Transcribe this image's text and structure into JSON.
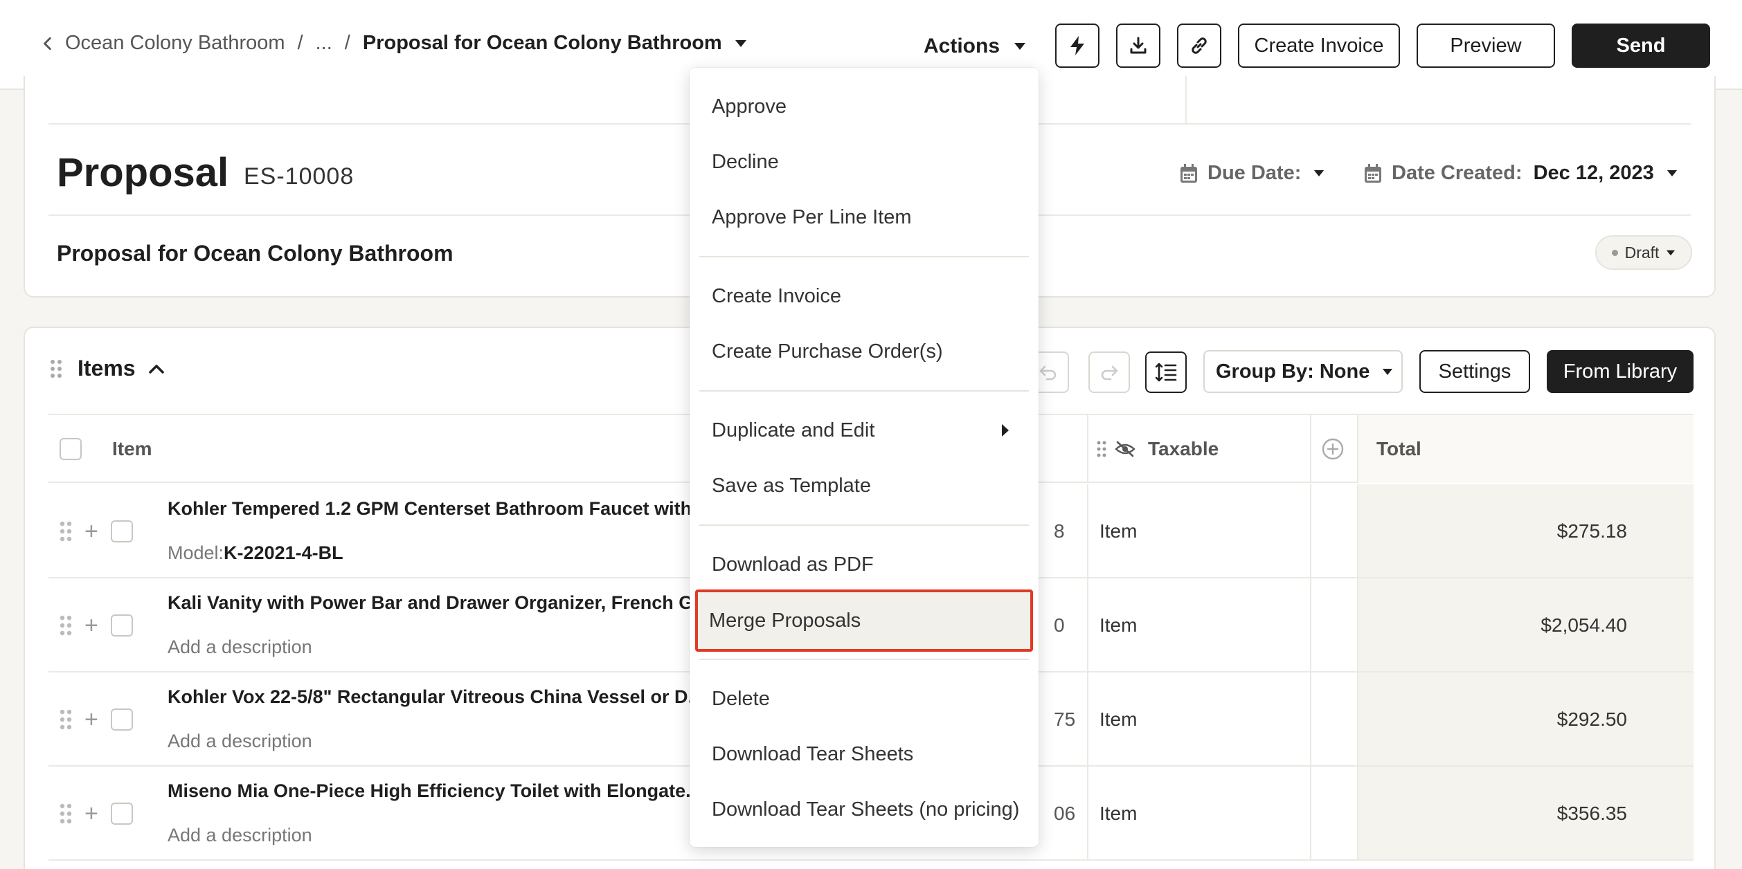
{
  "breadcrumb": {
    "parent": "Ocean Colony Bathroom",
    "separator": "/",
    "ellipsis": "...",
    "current": "Proposal for Ocean Colony Bathroom"
  },
  "toolbar": {
    "actions_label": "Actions",
    "create_invoice_label": "Create Invoice",
    "preview_label": "Preview",
    "send_label": "Send"
  },
  "proposal": {
    "title": "Proposal",
    "number": "ES-10008",
    "due_date_label": "Due Date:",
    "date_created_label": "Date Created:",
    "date_created_value": "Dec 12, 2023",
    "subtitle": "Proposal for Ocean Colony Bathroom",
    "status": "Draft"
  },
  "items": {
    "title": "Items",
    "group_by_label": "Group By: None",
    "settings_label": "Settings",
    "from_library_label": "From Library",
    "columns": {
      "item": "Item",
      "taxable": "Taxable",
      "total": "Total"
    },
    "rows": [
      {
        "name": "Kohler Tempered 1.2 GPM Centerset Bathroom Faucet with...",
        "model_label": "Model:",
        "model_value": "K-22021-4-BL",
        "partial_value": "8",
        "taxable": "Item",
        "total": "$275.18"
      },
      {
        "name": "Kali Vanity with Power Bar and Drawer Organizer, French G...",
        "description": "Add a description",
        "partial_value": "0",
        "taxable": "Item",
        "total": "$2,054.40"
      },
      {
        "name": "Kohler Vox 22-5/8\" Rectangular Vitreous China Vessel or D...",
        "description": "Add a description",
        "partial_value": "75",
        "taxable": "Item",
        "total": "$292.50"
      },
      {
        "name": "Miseno Mia One-Piece High Efficiency Toilet with Elongate...",
        "description": "Add a description",
        "partial_value": "06",
        "taxable": "Item",
        "total": "$356.35"
      }
    ]
  },
  "menu": {
    "approve": "Approve",
    "decline": "Decline",
    "approve_per_line_item": "Approve Per Line Item",
    "create_invoice": "Create Invoice",
    "create_purchase_orders": "Create Purchase Order(s)",
    "duplicate_and_edit": "Duplicate and Edit",
    "save_as_template": "Save as Template",
    "download_as_pdf": "Download as PDF",
    "merge_proposals": "Merge Proposals",
    "delete": "Delete",
    "download_tear_sheets": "Download Tear Sheets",
    "download_tear_sheets_no_pricing": "Download Tear Sheets (no pricing)"
  },
  "colors": {
    "primary_dark": "#1f1f1f",
    "page_background": "#f6f5f1",
    "highlight_outline": "#e03b24"
  },
  "icons": {
    "back": "chevron-left-icon",
    "breadcrumb_dropdown": "caret-down-icon",
    "quick_action": "lightning-icon",
    "download": "download-icon",
    "copy_link": "link-icon",
    "calendar": "calendar-icon",
    "drag": "drag-handle-icon",
    "collapse": "chevron-up-icon",
    "undo": "undo-icon",
    "redo": "redo-icon",
    "line_spacing": "line-spacing-icon",
    "hidden": "eye-off-icon",
    "add_column": "plus-circle-icon",
    "submenu": "caret-right-icon"
  }
}
